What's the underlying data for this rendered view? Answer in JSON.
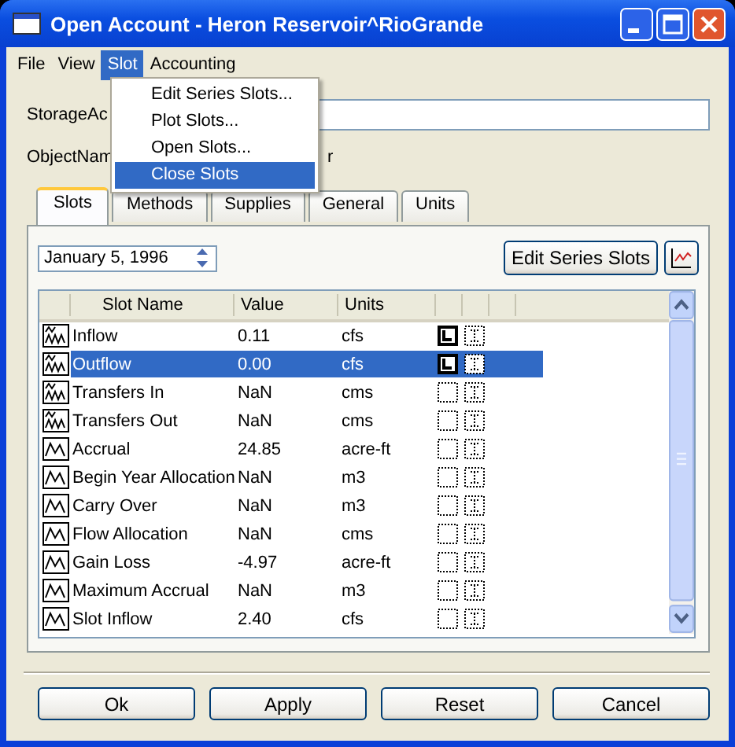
{
  "window": {
    "title": "Open Account - Heron Reservoir^RioGrande"
  },
  "menu_bar": [
    {
      "label": "File",
      "selected": false
    },
    {
      "label": "View",
      "selected": false
    },
    {
      "label": "Slot",
      "selected": true
    },
    {
      "label": "Accounting",
      "selected": false
    }
  ],
  "open_menu": {
    "items": [
      {
        "label": "Edit Series Slots...",
        "selected": false
      },
      {
        "label": "Plot Slots...",
        "selected": false
      },
      {
        "label": "Open Slots...",
        "selected": false
      },
      {
        "label": "Close Slots",
        "selected": true
      }
    ]
  },
  "fields": [
    {
      "label": "StorageAc"
    },
    {
      "label": "ObjectNam",
      "value": "r"
    }
  ],
  "tabs": [
    {
      "label": "Slots",
      "selected": true
    },
    {
      "label": "Methods",
      "selected": false
    },
    {
      "label": "Supplies",
      "selected": false
    },
    {
      "label": "General",
      "selected": false
    },
    {
      "label": "Units",
      "selected": false
    }
  ],
  "date": "January 5, 1996",
  "edit_button": "Edit Series Slots",
  "table": {
    "columns": [
      "Slot Name",
      "Value",
      "Units"
    ],
    "rows": [
      {
        "kind": "series",
        "name": "Inflow",
        "value": "0.11",
        "units": "cfs",
        "l_set": true,
        "selected": false
      },
      {
        "kind": "series",
        "name": "Outflow",
        "value": "0.00",
        "units": "cfs",
        "l_set": true,
        "selected": true
      },
      {
        "kind": "series",
        "name": "Transfers In",
        "value": "NaN",
        "units": "cms",
        "l_set": false,
        "selected": false
      },
      {
        "kind": "series",
        "name": "Transfers Out",
        "value": "NaN",
        "units": "cms",
        "l_set": false,
        "selected": false
      },
      {
        "kind": "scalar",
        "name": "Accrual",
        "value": "24.85",
        "units": "acre-ft",
        "l_set": false,
        "selected": false
      },
      {
        "kind": "scalar",
        "name": "Begin Year Allocation",
        "value": "NaN",
        "units": "m3",
        "l_set": false,
        "selected": false
      },
      {
        "kind": "scalar",
        "name": "Carry Over",
        "value": "NaN",
        "units": "m3",
        "l_set": false,
        "selected": false
      },
      {
        "kind": "scalar",
        "name": "Flow Allocation",
        "value": "NaN",
        "units": "cms",
        "l_set": false,
        "selected": false
      },
      {
        "kind": "scalar",
        "name": "Gain Loss",
        "value": "-4.97",
        "units": "acre-ft",
        "l_set": false,
        "selected": false
      },
      {
        "kind": "scalar",
        "name": "Maximum Accrual",
        "value": "NaN",
        "units": "m3",
        "l_set": false,
        "selected": false
      },
      {
        "kind": "scalar",
        "name": "Slot Inflow",
        "value": "2.40",
        "units": "cfs",
        "l_set": false,
        "selected": false
      }
    ]
  },
  "buttons": [
    "Ok",
    "Apply",
    "Reset",
    "Cancel"
  ]
}
